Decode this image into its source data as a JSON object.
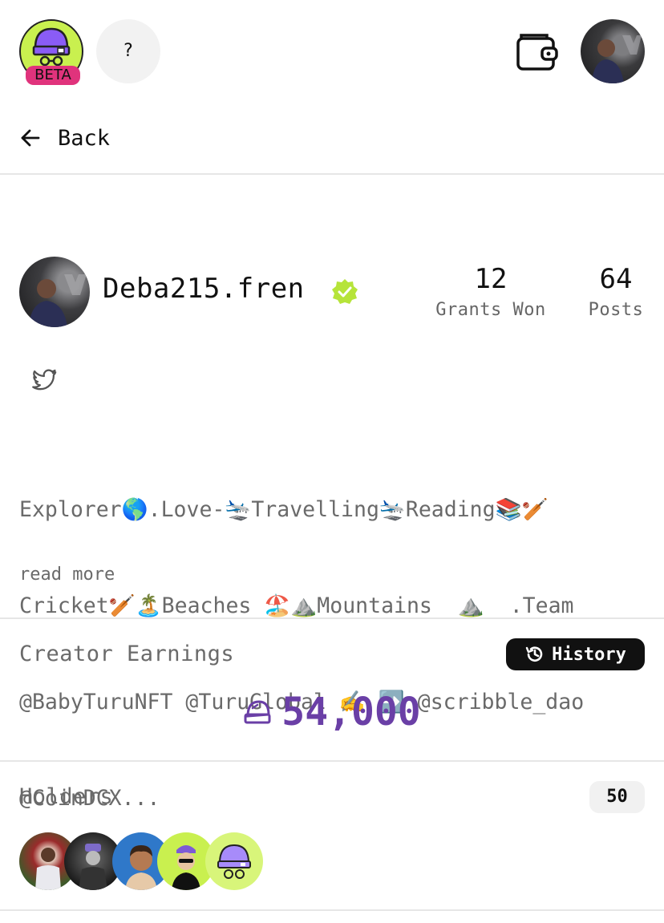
{
  "header": {
    "beta_label": "BETA",
    "help_label": "?"
  },
  "nav": {
    "back_label": "Back"
  },
  "profile": {
    "username": "Deba215.fren",
    "verified": true,
    "stats": [
      {
        "value": "12",
        "label": "Grants Won"
      },
      {
        "value": "64",
        "label": "Posts"
      }
    ],
    "bio_lines": [
      "Explorer🌎.Love-🛬Travelling🛬Reading📚🏏",
      "Cricket🏏🏝️Beaches 🏖️⛰️Mountains  ⛰️  .Team",
      "@BabyTuruNFT @TuruGlobal ✍️ ➡️ @scribble_dao",
      "@CoinDCX..."
    ],
    "read_more_label": "read more"
  },
  "earnings": {
    "title": "Creator Earnings",
    "history_label": "History",
    "value": "54,000",
    "accent_color": "#6a3fa6"
  },
  "holders": {
    "title": "Holders",
    "count": "50",
    "avatars": [
      "holder-1",
      "holder-2",
      "holder-3",
      "holder-4",
      "holder-5"
    ]
  },
  "colors": {
    "brand_green": "#c9f04f",
    "beta_pink": "#e0337c",
    "verified_green": "#b6e43a"
  }
}
